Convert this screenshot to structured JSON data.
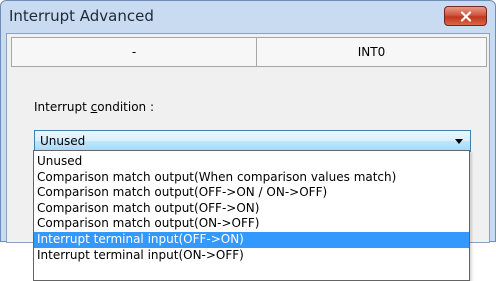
{
  "window": {
    "title": "Interrupt Advanced"
  },
  "header": {
    "col1": "-",
    "col2": "INT0"
  },
  "condition": {
    "label_pre": "Interrupt ",
    "label_accel": "c",
    "label_post": "ondition :"
  },
  "combo": {
    "value": "Unused"
  },
  "dropdown": {
    "items": [
      "Unused",
      "Comparison match output(When comparison values match)",
      "Comparison match output(OFF->ON / ON->OFF)",
      "Comparison match output(OFF->ON)",
      "Comparison match output(ON->OFF)",
      "Interrupt terminal input(OFF->ON)",
      "Interrupt terminal input(ON->OFF)"
    ],
    "selected_index": 5
  },
  "colors": {
    "selection": "#3399ff",
    "close_button": "#c0361d",
    "frame": "#c9dbf0"
  }
}
